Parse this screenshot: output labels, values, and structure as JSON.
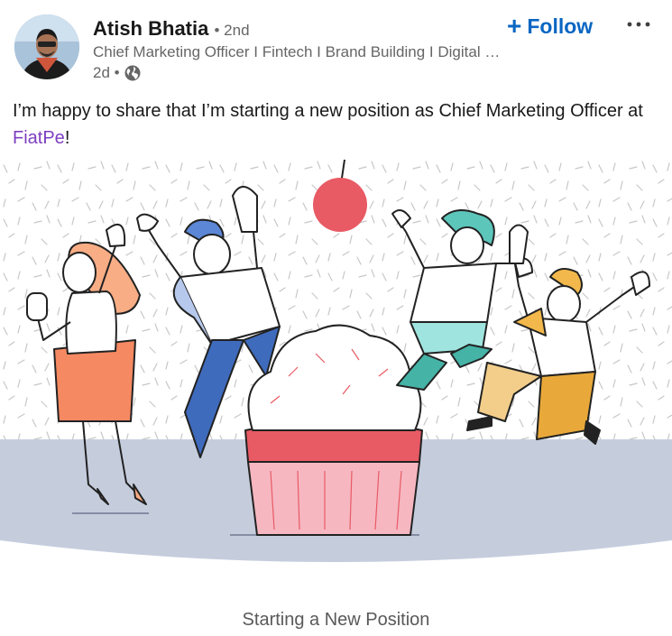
{
  "post": {
    "author": {
      "name": "Atish Bhatia",
      "degree": "• 2nd",
      "headline": "Chief Marketing Officer I Fintech I Brand Building I Digital Marketing",
      "time": "2d •",
      "visibility_icon": "globe-icon"
    },
    "follow_label": "Follow",
    "follow_plus": "+",
    "more_icon": "more-horizontal-icon",
    "text_prefix": "I’m happy to share that I’m starting a new position as Chief Marketing Officer at ",
    "mention": "FiatPe",
    "text_suffix": "!",
    "image_caption": "Starting a New Position",
    "colors": {
      "link_blue": "#0a66c2",
      "mention_purple": "#7d3fc1",
      "muted_text": "#666666",
      "floor": "#c5cddd"
    }
  }
}
